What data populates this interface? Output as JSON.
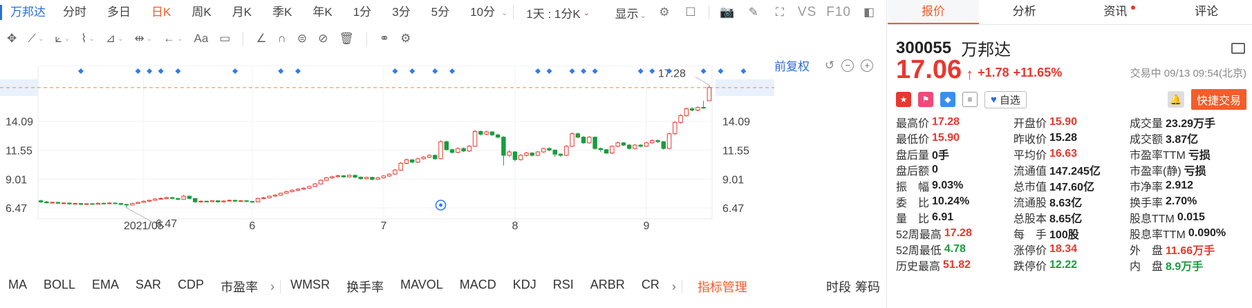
{
  "toolbar": {
    "stock_name": "万邦达",
    "periods": [
      "分时",
      "多日",
      "日K",
      "周K",
      "月K",
      "季K",
      "年K",
      "1分",
      "3分",
      "5分",
      "10分"
    ],
    "active_period": "日K",
    "multi_day_select": "1天 : 1分K",
    "display_label": "显示",
    "vs_label": "VS",
    "f10_label": "F10"
  },
  "restore": {
    "label": "前复权"
  },
  "draw_tools": {
    "text_tool": "Aa"
  },
  "chart_data": {
    "type": "candlestick",
    "y_ticks": [
      17.06,
      14.09,
      11.55,
      9.01,
      6.47
    ],
    "x_ticks": [
      "2021/05",
      "6",
      "7",
      "8",
      "9"
    ],
    "last_price_line": 17.06,
    "high_label": "17.28",
    "low_label": "6.47",
    "ylim": [
      5.5,
      19.0
    ],
    "candles": [
      [
        7.1,
        7.0,
        7.2,
        6.9
      ],
      [
        7.0,
        6.92,
        7.08,
        6.85
      ],
      [
        6.92,
        6.96,
        7.02,
        6.86
      ],
      [
        6.96,
        6.88,
        7.0,
        6.82
      ],
      [
        6.88,
        6.9,
        6.96,
        6.82
      ],
      [
        6.9,
        6.82,
        6.94,
        6.76
      ],
      [
        6.82,
        6.86,
        6.92,
        6.78
      ],
      [
        6.86,
        6.78,
        6.9,
        6.72
      ],
      [
        6.78,
        6.84,
        6.88,
        6.74
      ],
      [
        6.84,
        6.8,
        6.9,
        6.76
      ],
      [
        6.8,
        6.88,
        6.94,
        6.78
      ],
      [
        6.88,
        6.84,
        6.92,
        6.8
      ],
      [
        6.84,
        6.9,
        6.96,
        6.8
      ],
      [
        6.9,
        6.86,
        6.94,
        6.82
      ],
      [
        6.86,
        6.78,
        6.9,
        6.72
      ],
      [
        6.78,
        6.72,
        6.82,
        6.47
      ],
      [
        6.72,
        6.86,
        6.92,
        6.7
      ],
      [
        6.86,
        6.96,
        7.02,
        6.82
      ],
      [
        6.96,
        7.06,
        7.12,
        6.92
      ],
      [
        7.06,
        7.14,
        7.2,
        7.0
      ],
      [
        7.14,
        7.26,
        7.32,
        7.1
      ],
      [
        7.26,
        7.3,
        7.4,
        7.2
      ],
      [
        7.3,
        7.38,
        7.46,
        7.24
      ],
      [
        7.38,
        7.3,
        7.44,
        7.22
      ],
      [
        7.3,
        7.22,
        7.36,
        7.16
      ],
      [
        7.22,
        7.5,
        7.62,
        7.18
      ],
      [
        7.5,
        7.3,
        7.56,
        7.22
      ],
      [
        7.3,
        7.0,
        7.34,
        6.92
      ],
      [
        7.0,
        7.06,
        7.12,
        6.94
      ],
      [
        7.06,
        7.02,
        7.12,
        6.96
      ],
      [
        7.02,
        7.1,
        7.16,
        6.98
      ],
      [
        7.1,
        7.0,
        7.14,
        6.94
      ],
      [
        7.0,
        7.08,
        7.14,
        6.96
      ],
      [
        7.08,
        7.14,
        7.2,
        7.02
      ],
      [
        7.14,
        7.06,
        7.18,
        7.0
      ],
      [
        7.06,
        7.1,
        7.16,
        7.0
      ],
      [
        7.1,
        7.04,
        7.14,
        6.98
      ],
      [
        7.04,
        7.0,
        7.08,
        6.92
      ],
      [
        7.0,
        7.3,
        7.36,
        6.96
      ],
      [
        7.3,
        7.36,
        7.44,
        7.24
      ],
      [
        7.36,
        7.5,
        7.56,
        7.3
      ],
      [
        7.5,
        7.6,
        7.66,
        7.44
      ],
      [
        7.6,
        7.76,
        7.82,
        7.54
      ],
      [
        7.76,
        7.9,
        7.98,
        7.7
      ],
      [
        7.9,
        8.02,
        8.1,
        7.84
      ],
      [
        8.02,
        8.12,
        8.2,
        7.96
      ],
      [
        8.12,
        8.2,
        8.28,
        8.06
      ],
      [
        8.2,
        8.36,
        8.44,
        8.14
      ],
      [
        8.36,
        8.58,
        8.66,
        8.3
      ],
      [
        8.58,
        8.9,
        8.98,
        8.52
      ],
      [
        8.9,
        9.12,
        9.2,
        8.84
      ],
      [
        9.12,
        9.22,
        9.3,
        9.04
      ],
      [
        9.22,
        9.3,
        9.4,
        9.14
      ],
      [
        9.3,
        9.2,
        9.36,
        9.12
      ],
      [
        9.2,
        9.34,
        9.42,
        9.14
      ],
      [
        9.34,
        9.18,
        9.4,
        9.08
      ],
      [
        9.18,
        9.04,
        9.24,
        8.96
      ],
      [
        9.04,
        9.16,
        9.22,
        8.98
      ],
      [
        9.16,
        8.98,
        9.22,
        8.9
      ],
      [
        8.98,
        9.12,
        9.2,
        8.92
      ],
      [
        9.12,
        9.28,
        9.36,
        9.06
      ],
      [
        9.28,
        9.44,
        9.52,
        9.2
      ],
      [
        9.44,
        9.8,
        9.9,
        9.38
      ],
      [
        9.8,
        10.4,
        10.52,
        9.72
      ],
      [
        10.4,
        10.7,
        10.82,
        10.3
      ],
      [
        10.7,
        10.5,
        10.78,
        10.4
      ],
      [
        10.5,
        10.8,
        10.9,
        10.42
      ],
      [
        10.8,
        10.94,
        11.02,
        10.72
      ],
      [
        10.94,
        11.1,
        11.2,
        10.86
      ],
      [
        11.1,
        10.8,
        11.18,
        10.7
      ],
      [
        10.8,
        12.3,
        12.42,
        10.74
      ],
      [
        12.3,
        11.6,
        12.4,
        11.5
      ],
      [
        11.6,
        11.36,
        11.7,
        11.24
      ],
      [
        11.36,
        11.7,
        11.8,
        11.28
      ],
      [
        11.7,
        11.48,
        11.8,
        11.38
      ],
      [
        11.48,
        11.9,
        12.0,
        11.4
      ],
      [
        11.9,
        13.2,
        13.34,
        11.84
      ],
      [
        13.2,
        12.96,
        13.3,
        12.84
      ],
      [
        12.96,
        13.16,
        13.28,
        12.88
      ],
      [
        13.16,
        12.9,
        13.22,
        12.8
      ],
      [
        12.9,
        12.7,
        13.0,
        12.58
      ],
      [
        12.7,
        11.1,
        12.8,
        10.2
      ],
      [
        11.1,
        11.4,
        11.54,
        10.98
      ],
      [
        11.4,
        10.72,
        11.48,
        10.56
      ],
      [
        10.72,
        11.1,
        11.22,
        10.64
      ],
      [
        11.1,
        11.3,
        11.4,
        11.0
      ],
      [
        11.3,
        11.1,
        11.38,
        11.0
      ],
      [
        11.1,
        11.4,
        11.48,
        11.02
      ],
      [
        11.4,
        11.7,
        11.78,
        11.32
      ],
      [
        11.7,
        11.56,
        11.8,
        11.46
      ],
      [
        11.56,
        11.2,
        11.62,
        10.96
      ],
      [
        11.2,
        11.1,
        11.28,
        10.96
      ],
      [
        11.1,
        11.9,
        12.0,
        11.04
      ],
      [
        11.9,
        13.0,
        13.1,
        11.84
      ],
      [
        13.0,
        12.7,
        13.1,
        12.6
      ],
      [
        12.7,
        12.2,
        12.8,
        12.1
      ],
      [
        12.2,
        12.7,
        12.8,
        12.12
      ],
      [
        12.7,
        11.7,
        12.76,
        11.6
      ],
      [
        11.7,
        11.6,
        11.8,
        11.4
      ],
      [
        11.6,
        11.3,
        11.66,
        11.2
      ],
      [
        11.3,
        11.9,
        11.98,
        11.22
      ],
      [
        11.9,
        12.2,
        12.3,
        11.82
      ],
      [
        12.2,
        12.0,
        12.28,
        11.9
      ],
      [
        12.0,
        11.7,
        12.1,
        11.62
      ],
      [
        11.7,
        12.0,
        12.1,
        11.62
      ],
      [
        12.0,
        11.9,
        12.08,
        11.8
      ],
      [
        11.9,
        12.2,
        12.3,
        11.84
      ],
      [
        12.2,
        12.4,
        12.5,
        12.12
      ],
      [
        12.4,
        12.3,
        12.48,
        12.2
      ],
      [
        12.3,
        11.7,
        12.36,
        11.6
      ],
      [
        11.7,
        13.0,
        13.1,
        11.62
      ],
      [
        13.0,
        14.0,
        14.12,
        12.92
      ],
      [
        14.0,
        14.6,
        14.72,
        13.9
      ],
      [
        14.6,
        15.2,
        15.3,
        14.5
      ],
      [
        15.2,
        15.08,
        15.36,
        14.96
      ],
      [
        15.08,
        15.32,
        15.4,
        14.98
      ],
      [
        15.32,
        15.28,
        15.9,
        15.2
      ],
      [
        15.9,
        17.06,
        17.28,
        15.9
      ]
    ],
    "markers": [
      7,
      17,
      19,
      21,
      24,
      34,
      42,
      45,
      62,
      65,
      69,
      72,
      87,
      89,
      93,
      95,
      97,
      105,
      107,
      110,
      116,
      119,
      123
    ]
  },
  "indicators": {
    "items_left": [
      "MA",
      "BOLL",
      "EMA",
      "SAR",
      "CDP",
      "市盈率"
    ],
    "items_right": [
      "WMSR",
      "换手率",
      "MAVOL",
      "MACD",
      "KDJ",
      "RSI",
      "ARBR",
      "CR"
    ],
    "manager": "指标管理",
    "tail": [
      "时段",
      "筹码"
    ]
  },
  "quote": {
    "tabs": [
      "报价",
      "分析",
      "资讯",
      "评论"
    ],
    "active_tab": "报价",
    "code": "300055",
    "name": "万邦达",
    "last": "17.06",
    "change": "+1.78",
    "change_pct": "+11.65%",
    "status_time": "交易中 09/13 09:54(北京)",
    "watch_label": "自选",
    "trade_label": "快捷交易",
    "rows": [
      [
        {
          "k": "最高价",
          "v": "17.28",
          "c": "red"
        },
        {
          "k": "开盘价",
          "v": "15.90",
          "c": "red"
        },
        {
          "k": "成交量",
          "v": "23.29万手",
          "c": ""
        }
      ],
      [
        {
          "k": "最低价",
          "v": "15.90",
          "c": "red"
        },
        {
          "k": "昨收价",
          "v": "15.28",
          "c": ""
        },
        {
          "k": "成交额",
          "v": "3.87亿",
          "c": ""
        }
      ],
      [
        {
          "k": "盘后量",
          "v": "0手",
          "c": ""
        },
        {
          "k": "平均价",
          "v": "16.63",
          "c": "red"
        },
        {
          "k": "市盈率TTM",
          "v": "亏损",
          "c": ""
        }
      ],
      [
        {
          "k": "盘后额",
          "v": "0",
          "c": ""
        },
        {
          "k": "流通值",
          "v": "147.245亿",
          "c": ""
        },
        {
          "k": "市盈率(静)",
          "v": "亏损",
          "c": ""
        }
      ],
      [
        {
          "k": "振　幅",
          "v": "9.03%",
          "c": ""
        },
        {
          "k": "总市值",
          "v": "147.60亿",
          "c": ""
        },
        {
          "k": "市净率",
          "v": "2.912",
          "c": ""
        }
      ],
      [
        {
          "k": "委　比",
          "v": "10.24%",
          "c": ""
        },
        {
          "k": "流通股",
          "v": "8.63亿",
          "c": ""
        },
        {
          "k": "换手率",
          "v": "2.70%",
          "c": ""
        }
      ],
      [
        {
          "k": "量　比",
          "v": "6.91",
          "c": ""
        },
        {
          "k": "总股本",
          "v": "8.65亿",
          "c": ""
        },
        {
          "k": "股息TTM",
          "v": "0.015",
          "c": ""
        }
      ],
      [
        {
          "k": "52周最高",
          "v": "17.28",
          "c": "red"
        },
        {
          "k": "每　手",
          "v": "100股",
          "c": ""
        },
        {
          "k": "股息率TTM",
          "v": "0.090%",
          "c": ""
        }
      ],
      [
        {
          "k": "52周最低",
          "v": "4.78",
          "c": "green"
        },
        {
          "k": "涨停价",
          "v": "18.34",
          "c": "red"
        },
        {
          "k": "外　盘",
          "v": "11.66万手",
          "c": "red"
        }
      ],
      [
        {
          "k": "历史最高",
          "v": "51.82",
          "c": "red"
        },
        {
          "k": "跌停价",
          "v": "12.22",
          "c": "green"
        },
        {
          "k": "内　盘",
          "v": "8.9万手",
          "c": "green"
        }
      ]
    ]
  },
  "colors": {
    "up": "#e8382f",
    "down": "#1a9c3e",
    "accent": "#f25d2c",
    "link": "#2a6fd6",
    "marker": "#2f7bf0"
  }
}
